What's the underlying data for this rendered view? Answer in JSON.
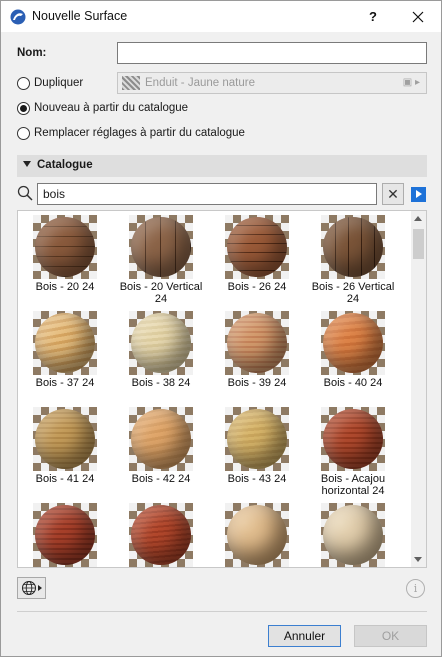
{
  "window": {
    "title": "Nouvelle Surface",
    "help": "?"
  },
  "form": {
    "name_label": "Nom:",
    "name_value": "",
    "dup_label": "Dupliquer",
    "dup_value": "Enduit - Jaune nature",
    "new_label": "Nouveau à partir du catalogue",
    "replace_label": "Remplacer réglages à partir du catalogue",
    "selected_option": "new"
  },
  "catalog": {
    "section_label": "Catalogue",
    "search_value": "bois",
    "items": [
      {
        "name": "Bois - 20 24",
        "texture": "planks-h"
      },
      {
        "name": "Bois - 20 Vertical 24",
        "texture": "planks-v"
      },
      {
        "name": "Bois - 26 24",
        "texture": "planks-h-dark"
      },
      {
        "name": "Bois - 26 Vertical 24",
        "texture": "planks-v-dark"
      },
      {
        "name": "Bois - 37 24",
        "texture": "light-oak"
      },
      {
        "name": "Bois - 38 24",
        "texture": "pale-maple"
      },
      {
        "name": "Bois - 39 24",
        "texture": "striped-pine"
      },
      {
        "name": "Bois - 40 24",
        "texture": "orange-cherry"
      },
      {
        "name": "Bois - 41 24",
        "texture": "golden-oak"
      },
      {
        "name": "Bois - 42 24",
        "texture": "honey-pine"
      },
      {
        "name": "Bois - 43 24",
        "texture": "birch"
      },
      {
        "name": "Bois - Acajou horizontal 24",
        "texture": "mahogany"
      },
      {
        "name": "",
        "texture": "red-mahogany"
      },
      {
        "name": "",
        "texture": "red-wood"
      },
      {
        "name": "",
        "texture": "cork"
      },
      {
        "name": "",
        "texture": "sand-wood"
      }
    ]
  },
  "footer": {
    "cancel_label": "Annuler",
    "ok_label": "OK",
    "info": "i"
  },
  "colors": {
    "accent": "#1e72d8",
    "title_bar": "#ffffff",
    "dialog_bg": "#f0f0f0"
  }
}
